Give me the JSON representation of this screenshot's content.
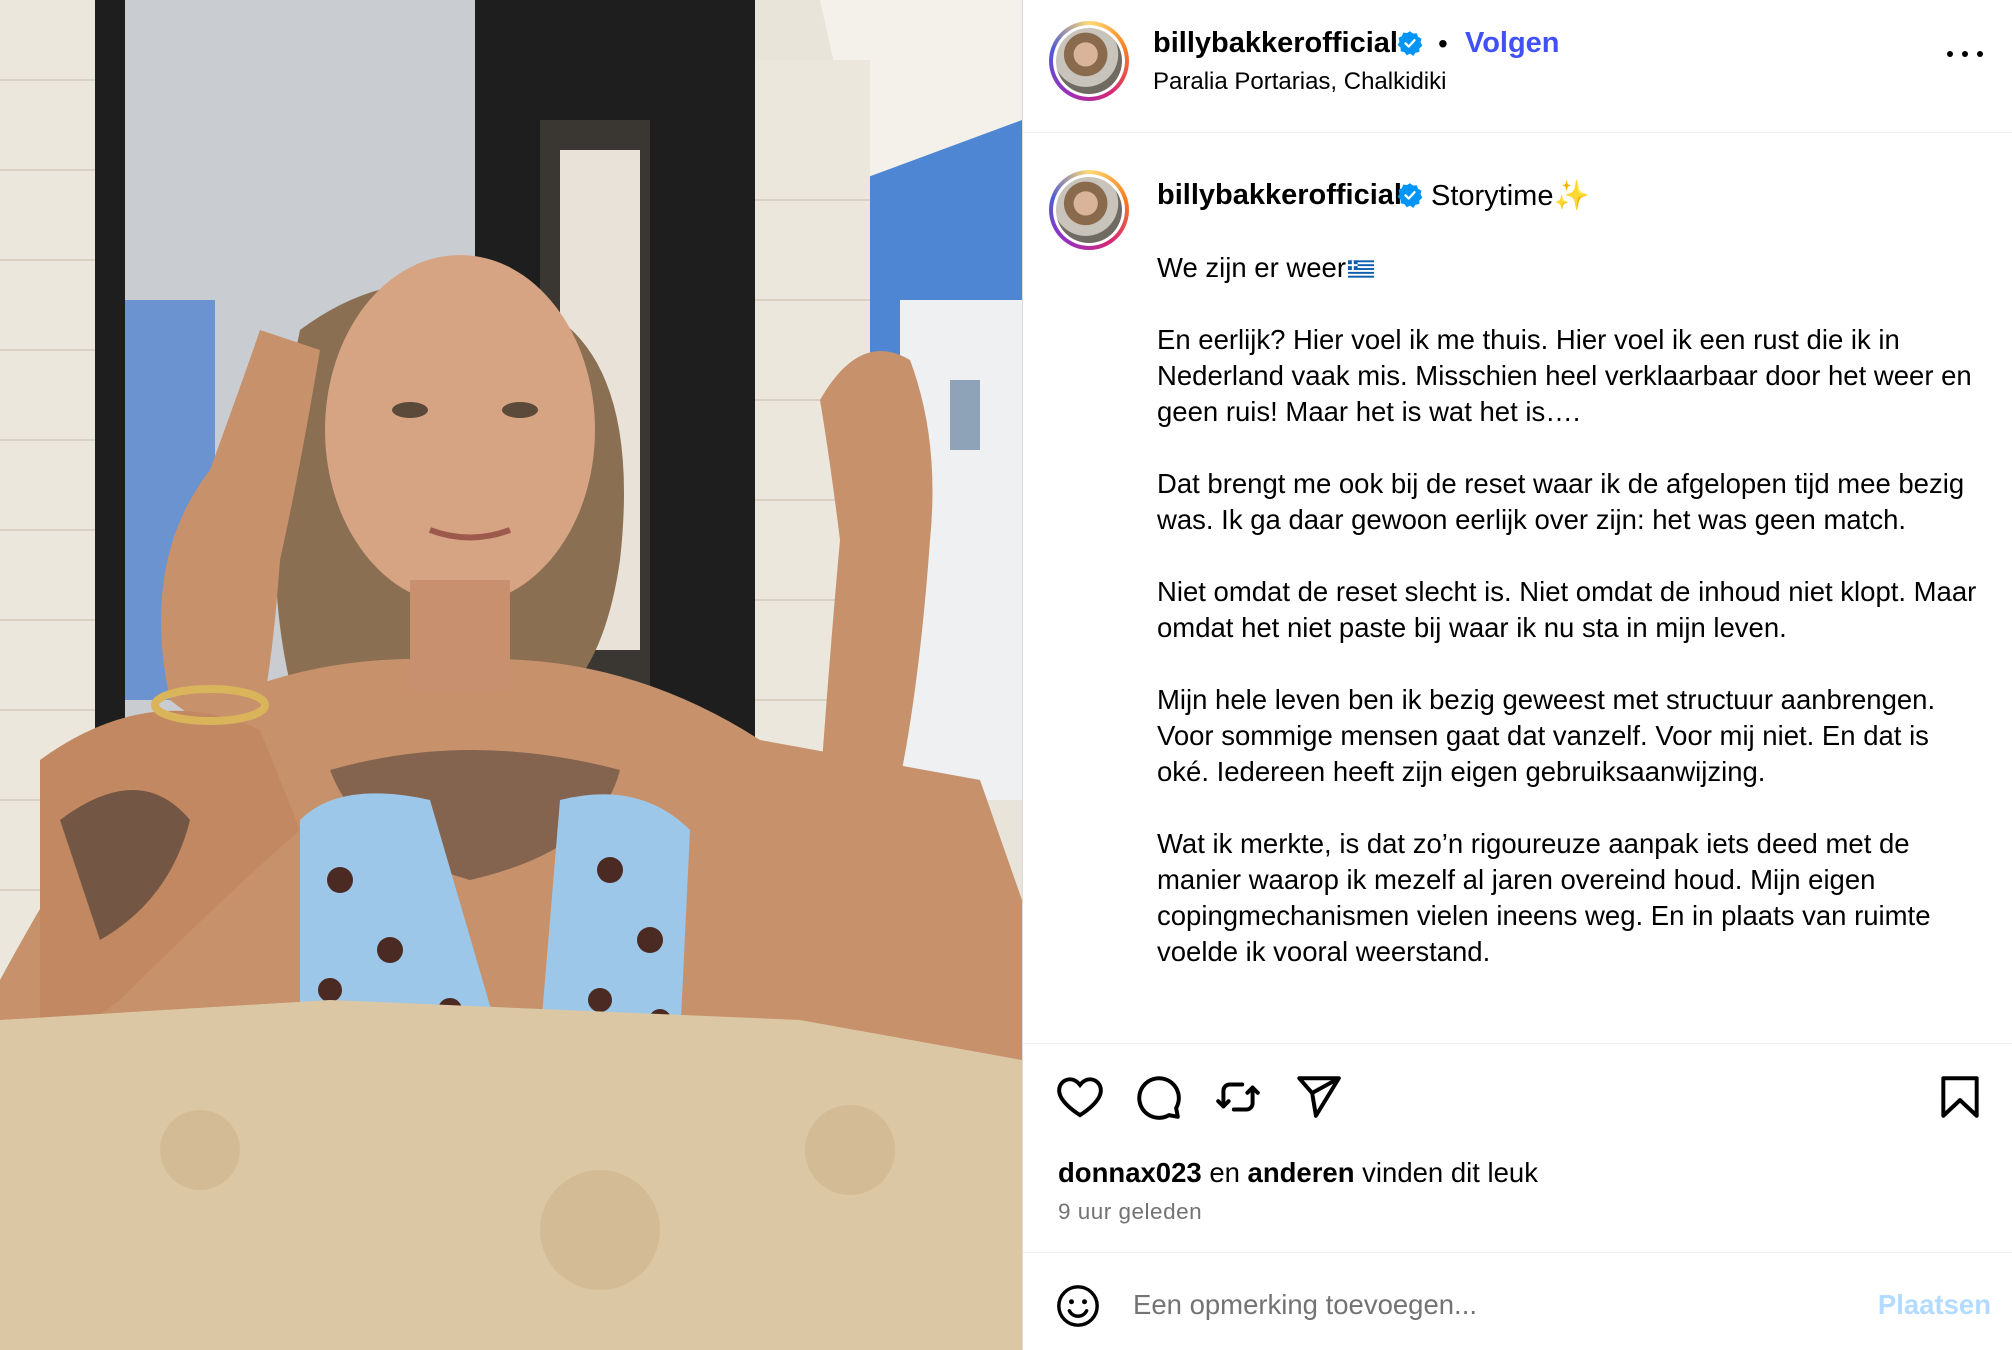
{
  "post": {
    "username": "billybakkerofficial",
    "verified": true,
    "follow_label": "Volgen",
    "separator": "•",
    "location": "Paralia Portarias, Chalkidiki",
    "more_icon": "more-options-icon"
  },
  "caption": {
    "username": "billybakkerofficial",
    "title": "Storytime",
    "title_emoji": "✨",
    "paragraphs": [
      "We zijn er weer",
      "En eerlijk? Hier voel ik me thuis. Hier voel ik een rust die ik in Nederland vaak mis. Misschien heel verklaarbaar door het weer en geen ruis! Maar het is wat het is….",
      "Dat brengt me ook bij de reset waar ik de afgelopen tijd mee bezig was. Ik ga daar gewoon eerlijk over zijn: het was geen match.",
      "Niet omdat de reset slecht is. Niet omdat de inhoud niet klopt. Maar omdat het niet paste bij waar ik nu sta in mijn leven.",
      "Mijn hele leven ben ik bezig geweest met structuur aanbrengen. Voor sommige mensen gaat dat vanzelf. Voor mij niet. En dat is oké. Iedereen heeft zijn eigen gebruiksaanwijzing.",
      "Wat ik merkte, is dat zo’n rigoureuze aanpak iets deed met de manier waarop ik mezelf al jaren overeind houd. Mijn eigen copingmechanismen vielen ineens weg. En in plaats van ruimte voelde ik vooral weerstand."
    ],
    "flag_icon": "greek-flag-icon"
  },
  "actions": {
    "icons": [
      "heart-icon",
      "comment-icon",
      "repost-icon",
      "share-icon",
      "bookmark-icon"
    ]
  },
  "likes": {
    "first_user": "donnax023",
    "connector": "en",
    "others": "anderen",
    "suffix": "vinden dit leuk"
  },
  "timestamp": "9 uur geleden",
  "comment_box": {
    "placeholder": "Een opmerking toevoegen...",
    "post_label": "Plaatsen",
    "emoji_icon": "emoji-icon"
  },
  "colors": {
    "link_blue": "#4150f7",
    "verified_blue": "#0095f6",
    "post_button_disabled": "#b3dbff",
    "secondary_text": "#737373"
  }
}
